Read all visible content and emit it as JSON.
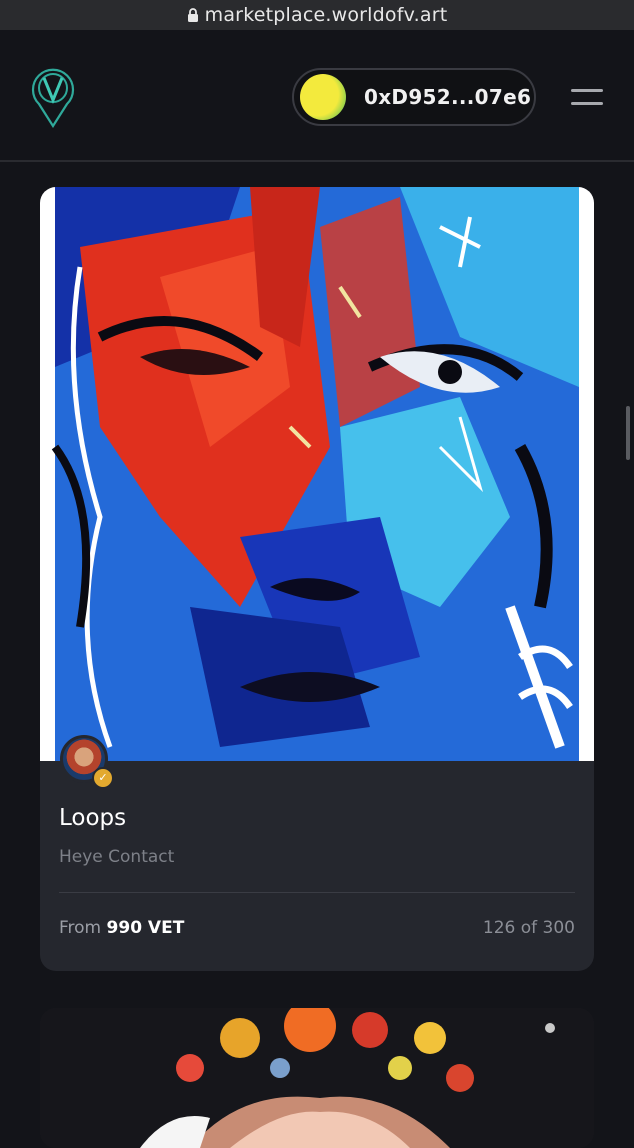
{
  "browser": {
    "url": "marketplace.worldofv.art"
  },
  "header": {
    "wallet_address": "0xD952...07e6"
  },
  "card": {
    "title": "Loops",
    "artist": "Heye Contact",
    "price_prefix": "From",
    "price": "990 VET",
    "edition": "126 of 300"
  }
}
